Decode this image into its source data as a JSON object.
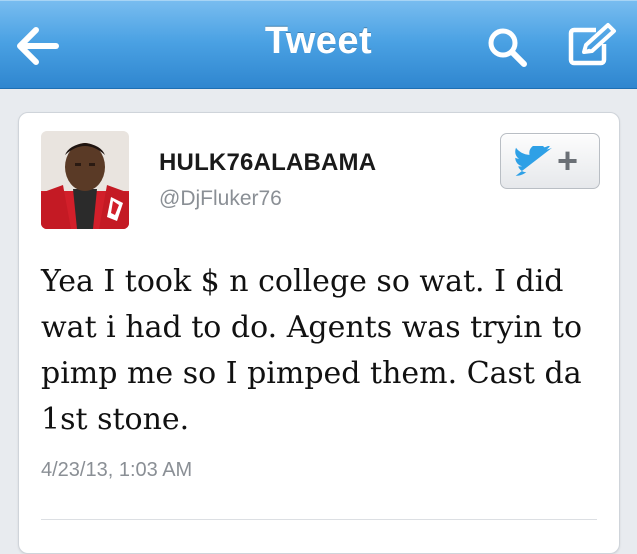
{
  "navbar": {
    "title": "Tweet",
    "back_icon": "back-arrow-icon",
    "search_icon": "search-icon",
    "compose_icon": "compose-icon",
    "bar_color": "#4aa1e3"
  },
  "tweet": {
    "display_name": "HULK76ALABAMA",
    "handle": "@DjFluker76",
    "text": "Yea I took $ n college so wat. I did wat i had to do. Agents was tryin to pimp me so I pimped them. Cast da 1st stone.",
    "timestamp": "4/23/13, 1:03 AM",
    "follow_button_label": "+",
    "follow_icon": "twitter-bird-icon",
    "avatar_icon": "avatar-photo"
  }
}
